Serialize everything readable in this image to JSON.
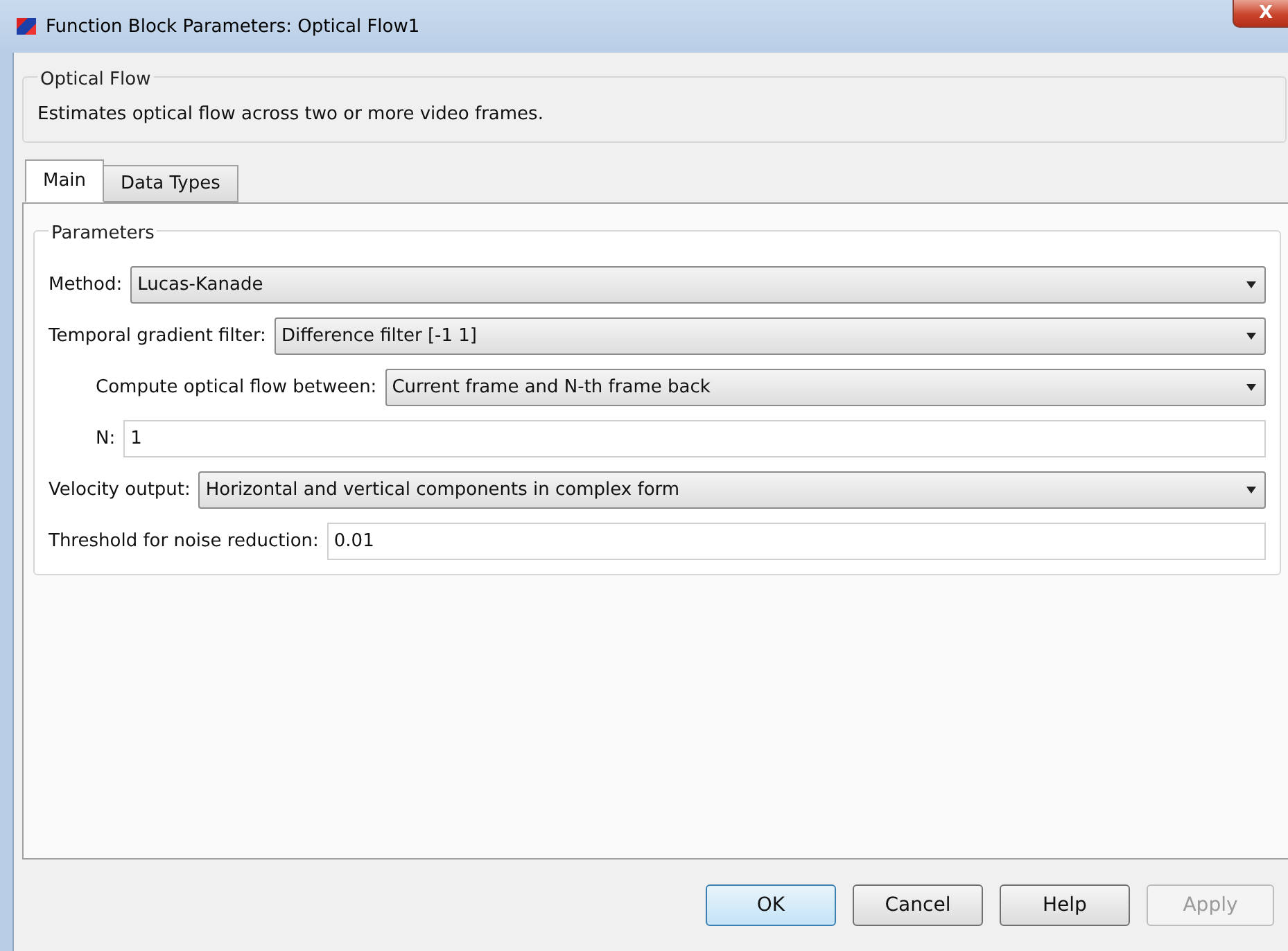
{
  "window": {
    "title": "Function Block Parameters: Optical Flow1",
    "close_label": "X"
  },
  "block": {
    "group_title": "Optical Flow",
    "description": "Estimates optical flow across two or more video frames."
  },
  "tabs": [
    {
      "label": "Main",
      "selected": true
    },
    {
      "label": "Data Types",
      "selected": false
    }
  ],
  "parameters": {
    "group_title": "Parameters",
    "fields": [
      {
        "kind": "dropdown",
        "label": "Method:",
        "value": "Lucas-Kanade"
      },
      {
        "kind": "dropdown",
        "label": "Temporal gradient filter:",
        "value": "Difference filter [-1 1]",
        "children": [
          {
            "kind": "dropdown",
            "label": "Compute optical flow between:",
            "value": "Current frame and N-th frame back"
          },
          {
            "kind": "text",
            "label": "N:",
            "value": "1"
          }
        ]
      },
      {
        "kind": "dropdown",
        "label": "Velocity output:",
        "value": "Horizontal and vertical components in complex form"
      },
      {
        "kind": "text",
        "label": "Threshold for noise reduction:",
        "value": "0.01"
      }
    ]
  },
  "buttons": [
    {
      "label": "OK",
      "default": true,
      "disabled": false
    },
    {
      "label": "Cancel",
      "default": false,
      "disabled": false
    },
    {
      "label": "Help",
      "default": false,
      "disabled": false
    },
    {
      "label": "Apply",
      "default": false,
      "disabled": true
    }
  ]
}
